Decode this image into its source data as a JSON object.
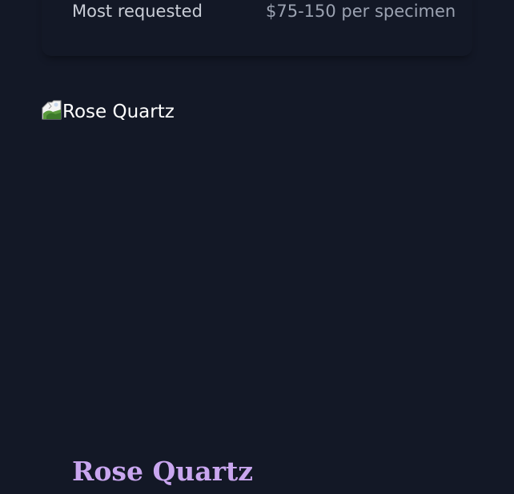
{
  "previous_card": {
    "label": "Most requested",
    "price": "$75-150 per specimen"
  },
  "crystal_card": {
    "image_alt": "Rose Quartz",
    "title": "Rose Quartz"
  },
  "colors": {
    "background": "#131826",
    "title_accent": "#c9a6ef",
    "label_text": "#c9cdd6",
    "price_text": "#9ba2b1"
  },
  "icons": {
    "broken_image": "broken-image-icon"
  }
}
